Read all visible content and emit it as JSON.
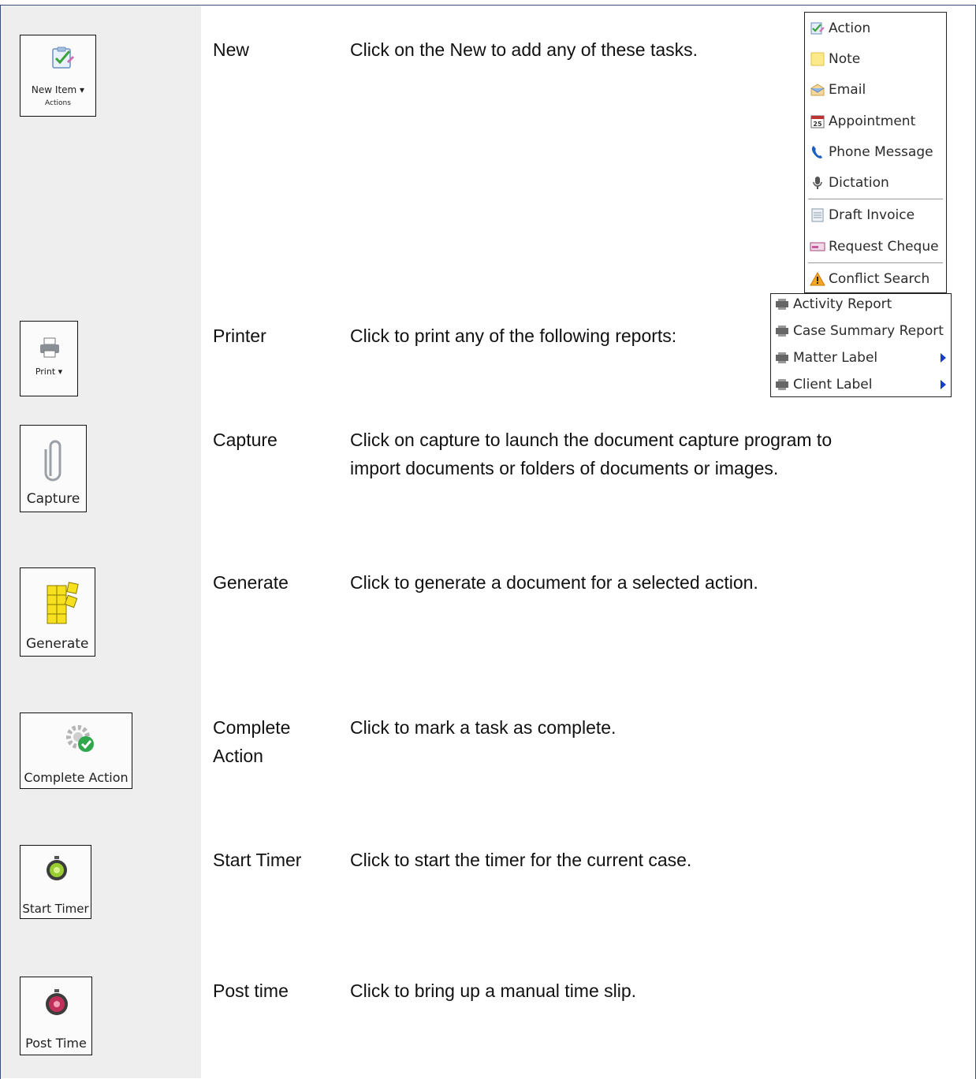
{
  "rows": {
    "new": {
      "button": {
        "label": "New Item ▾",
        "sublabel": "Actions"
      },
      "name": "New",
      "description": "Click on the New to add any of these tasks."
    },
    "print": {
      "button": {
        "label": "Print ▾"
      },
      "name": "Printer",
      "description": "Click to print any of the following reports:"
    },
    "capture": {
      "button": {
        "label": "Capture"
      },
      "name": "Capture",
      "description_line1": "Click on capture to launch the document capture program to",
      "description_line2": "import documents or folders of documents or images."
    },
    "generate": {
      "button": {
        "label": "Generate"
      },
      "name": "Generate",
      "description": "Click to generate a document for a selected action."
    },
    "complete": {
      "button": {
        "label": "Complete Action"
      },
      "name_line1": "Complete",
      "name_line2": "Action",
      "description": "Click to mark a task as complete."
    },
    "start_timer": {
      "button": {
        "label": "Start Timer"
      },
      "name": "Start Timer",
      "description": "Click to start the timer for the current case."
    },
    "post_time": {
      "button": {
        "label": "Post Time"
      },
      "name": "Post time",
      "description": "Click to bring up a manual time slip."
    }
  },
  "new_menu": {
    "items": [
      {
        "label": "Action",
        "icon": "action-icon"
      },
      {
        "label": "Note",
        "icon": "note-icon"
      },
      {
        "label": "Email",
        "icon": "email-icon"
      },
      {
        "label": "Appointment",
        "icon": "calendar-icon"
      },
      {
        "label": "Phone Message",
        "icon": "phone-icon"
      },
      {
        "label": "Dictation",
        "icon": "microphone-icon"
      },
      {
        "label": "Draft Invoice",
        "icon": "invoice-icon"
      },
      {
        "label": "Request Cheque",
        "icon": "cheque-icon"
      },
      {
        "label": "Conflict Search",
        "icon": "warning-icon"
      }
    ],
    "calendar_day": "25"
  },
  "print_menu": {
    "items": [
      {
        "label": "Activity Report",
        "icon": "printer-icon"
      },
      {
        "label": "Case Summary Report",
        "icon": "printer-icon"
      },
      {
        "label": "Matter Label",
        "icon": "printer-icon",
        "submenu": true
      },
      {
        "label": "Client Label",
        "icon": "printer-icon",
        "submenu": true
      }
    ]
  },
  "colors": {
    "frame": "#3a4f7a",
    "left_column": "#eeeeee",
    "submenu_arrow": "#1a3ec0"
  }
}
